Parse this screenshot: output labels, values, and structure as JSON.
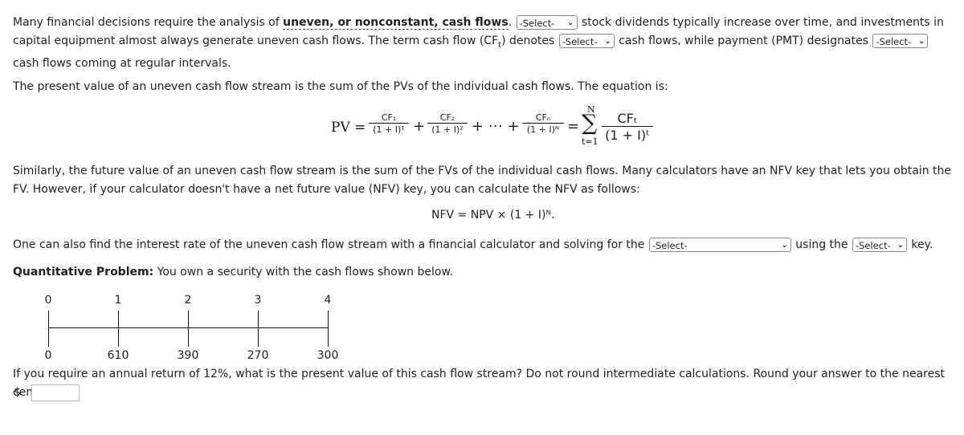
{
  "intro": {
    "t1": "Many financial decisions require the analysis of ",
    "keyword": "uneven, or nonconstant, cash flows",
    "t2": ".",
    "t3": " stock dividends typically increase over time, and investments in capital equipment almost always generate uneven cash flows. The term cash flow (CF",
    "sub_t": "t",
    "t4": ") denotes ",
    "t5": " cash flows, while payment (PMT) designates ",
    "t6": " cash flows coming at regular intervals."
  },
  "select_label": "-Select-",
  "pv_text": "The present value of an uneven cash flow stream is the sum of the PVs of the individual cash flows. The equation is:",
  "pv_equation": {
    "lhs": "PV =",
    "cf1": "CF₁",
    "d1": "(1 + I)¹",
    "cf2": "CF₂",
    "d2": "(1 + I)²",
    "dots": "+ ⋯ +",
    "cfn": "CFₙ",
    "dn": "(1 + I)ᴺ",
    "eq": "=",
    "sum_top": "N",
    "sum_bot": "t=1",
    "sum": "∑",
    "cft": "CFₜ",
    "dt": "(1 + I)ᵗ",
    "plus": "+"
  },
  "fv_text": "Similarly, the future value of an uneven cash flow stream is the sum of the FVs of the individual cash flows. Many calculators have an NFV key that lets you obtain the FV. However, if your calculator doesn't have a net future value (NFV) key, you can calculate the NFV as follows:",
  "nfv_equation": "NFV = NPV × (1 + I)ᴺ.",
  "irr_text": {
    "t1": "One can also find the interest rate of the uneven cash flow stream with a financial calculator and solving for the ",
    "t2": " using the ",
    "t3": " key."
  },
  "problem": {
    "label": "Quantitative Problem:",
    "text": " You own a security with the cash flows shown below."
  },
  "timeline": {
    "periods": [
      "0",
      "1",
      "2",
      "3",
      "4"
    ],
    "cash_flows": [
      "0",
      "610",
      "390",
      "270",
      "300"
    ]
  },
  "question": "If you require an annual return of 12%, what is the present value of this cash flow stream? Do not round intermediate calculations. Round your answer to the nearest cent.",
  "currency": "$",
  "answer": ""
}
